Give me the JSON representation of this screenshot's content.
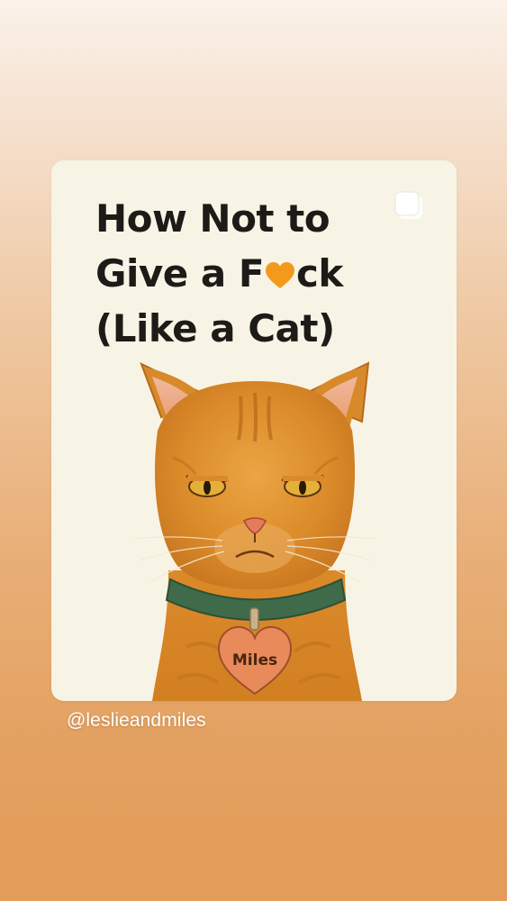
{
  "post": {
    "title_line1": "How Not to",
    "title_line2_part1": "Give a F",
    "title_line2_part2": "ck",
    "title_line3": "(Like a Cat)",
    "tag_text": "Miles",
    "icon_multi": "multi-post-icon",
    "icon_heart": "orange-heart-icon"
  },
  "author": {
    "handle": "@leslieandmiles"
  },
  "colors": {
    "card_background": "#f8f4e5",
    "title_text": "#1d1b18",
    "heart": "#f39a1c",
    "cat_fur": "#e0902c",
    "collar": "#3f6b4a",
    "tag": "#e88a5a"
  }
}
